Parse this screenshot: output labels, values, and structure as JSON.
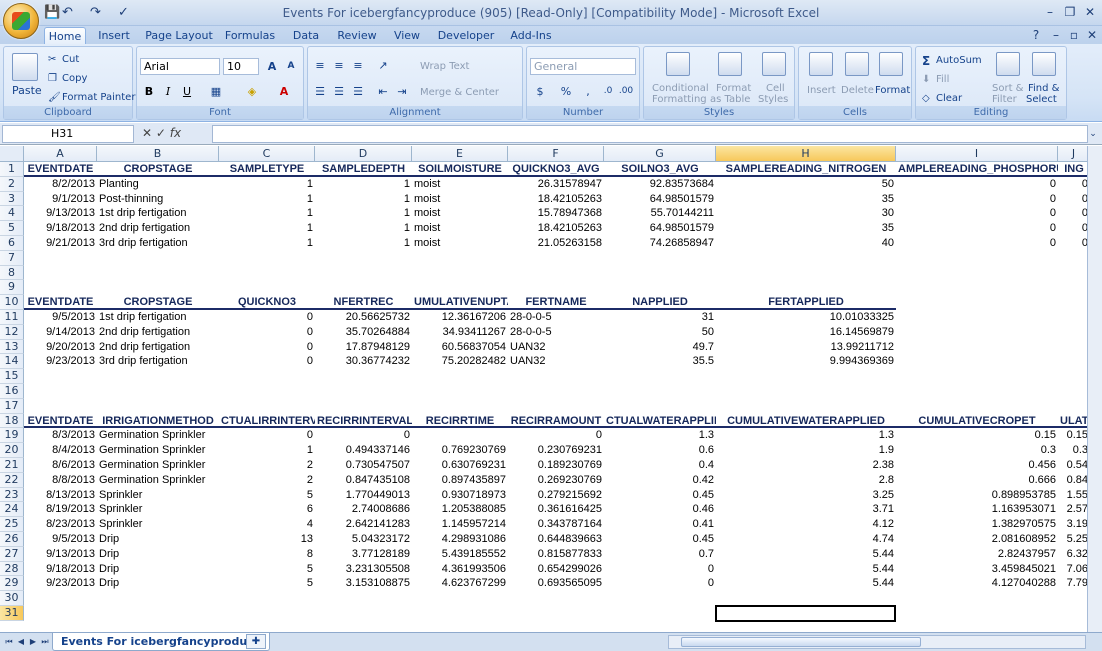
{
  "window": {
    "title": "Events For icebergfancyproduce (905)  [Read-Only]  [Compatibility Mode] - Microsoft Excel"
  },
  "qat": {
    "save": "💾",
    "undo": "↶",
    "redo": "↷",
    "custom": "✓"
  },
  "tabs": [
    "Home",
    "Insert",
    "Page Layout",
    "Formulas",
    "Data",
    "Review",
    "View",
    "Developer",
    "Add-Ins"
  ],
  "ribbon": {
    "clipboard": {
      "label": "Clipboard",
      "paste": "Paste",
      "cut": "Cut",
      "copy": "Copy",
      "format_painter": "Format Painter"
    },
    "font": {
      "label": "Font",
      "name": "Arial",
      "size": "10",
      "grow": "A",
      "shrink": "A",
      "bold": "B",
      "italic": "I",
      "underline": "U"
    },
    "alignment": {
      "label": "Alignment",
      "wrap": "Wrap Text",
      "merge": "Merge & Center"
    },
    "number": {
      "label": "Number",
      "format": "General",
      "currency": "$",
      "percent": "%",
      "comma": ","
    },
    "styles": {
      "label": "Styles",
      "conditional": "Conditional",
      "conditional2": "Formatting",
      "format_table": "Format",
      "format_table2": "as Table",
      "cell_styles": "Cell",
      "cell_styles2": "Styles"
    },
    "cells": {
      "label": "Cells",
      "insert": "Insert",
      "delete": "Delete",
      "format": "Format"
    },
    "editing": {
      "label": "Editing",
      "autosum": "AutoSum",
      "fill": "Fill",
      "clear": "Clear",
      "sort": "Sort &",
      "sort2": "Filter",
      "find": "Find &",
      "find2": "Select"
    }
  },
  "namebox": "H31",
  "columns": [
    "A",
    "B",
    "C",
    "D",
    "E",
    "F",
    "G",
    "H",
    "I",
    "J"
  ],
  "rows": [
    "1",
    "2",
    "3",
    "4",
    "5",
    "6",
    "7",
    "8",
    "9",
    "10",
    "11",
    "12",
    "13",
    "14",
    "15",
    "16",
    "17",
    "18",
    "19",
    "20",
    "21",
    "22",
    "23",
    "24",
    "25",
    "26",
    "27",
    "28",
    "29",
    "30",
    "31"
  ],
  "table1": {
    "headers": [
      "EVENTDATE",
      "CROPSTAGE",
      "SAMPLETYPE",
      "SAMPLEDEPTH",
      "SOILMOISTURE",
      "QUICKNO3_AVG",
      "SOILNO3_AVG",
      "SAMPLEREADING_NITROGEN",
      "AMPLEREADING_PHOSPHORUS",
      "ING"
    ],
    "rows": [
      [
        "8/2/2013",
        "Planting",
        "1",
        "1",
        "moist",
        "26.31578947",
        "92.83573684",
        "50",
        "0",
        "0"
      ],
      [
        "9/1/2013",
        "Post-thinning",
        "1",
        "1",
        "moist",
        "18.42105263",
        "64.98501579",
        "35",
        "0",
        "0"
      ],
      [
        "9/13/2013",
        "1st drip fertigation",
        "1",
        "1",
        "moist",
        "15.78947368",
        "55.70144211",
        "30",
        "0",
        "0"
      ],
      [
        "9/18/2013",
        "2nd drip fertigation",
        "1",
        "1",
        "moist",
        "18.42105263",
        "64.98501579",
        "35",
        "0",
        "0"
      ],
      [
        "9/21/2013",
        "3rd drip fertigation",
        "1",
        "1",
        "moist",
        "21.05263158",
        "74.26858947",
        "40",
        "0",
        "0"
      ]
    ]
  },
  "table2": {
    "headers": [
      "EVENTDATE",
      "CROPSTAGE",
      "QUICKNO3",
      "NFERTREC",
      "UMULATIVENUPTA",
      "FERTNAME",
      "NAPPLIED",
      "FERTAPPLIED"
    ],
    "rows": [
      [
        "9/5/2013",
        "1st drip fertigation",
        "0",
        "20.56625732",
        "12.36167206",
        "28-0-0-5",
        "31",
        "10.01033325"
      ],
      [
        "9/14/2013",
        "2nd drip fertigation",
        "0",
        "35.70264884",
        "34.93411267",
        "28-0-0-5",
        "50",
        "16.14569879"
      ],
      [
        "9/20/2013",
        "2nd drip fertigation",
        "0",
        "17.87948129",
        "60.56837054",
        "UAN32",
        "49.7",
        "13.99211712"
      ],
      [
        "9/23/2013",
        "3rd drip fertigation",
        "0",
        "30.36774232",
        "75.20282482",
        "UAN32",
        "35.5",
        "9.994369369"
      ]
    ]
  },
  "table3": {
    "headers": [
      "EVENTDATE",
      "IRRIGATIONMETHOD",
      "CTUALIRRINTERVA",
      "RECIRRINTERVAL",
      "RECIRRTIME",
      "RECIRRAMOUNT",
      "CTUALWATERAPPLIE",
      "CUMULATIVEWATERAPPLIED",
      "CUMULATIVECROPET",
      "ULAT"
    ],
    "rows": [
      [
        "8/3/2013",
        "Germination Sprinkler",
        "0",
        "0",
        "",
        "0",
        "1.3",
        "1.3",
        "0.15",
        "0.15"
      ],
      [
        "8/4/2013",
        "Germination Sprinkler",
        "1",
        "0.494337146",
        "0.769230769",
        "0.230769231",
        "0.6",
        "1.9",
        "0.3",
        "0.3"
      ],
      [
        "8/6/2013",
        "Germination Sprinkler",
        "2",
        "0.730547507",
        "0.630769231",
        "0.189230769",
        "0.4",
        "2.38",
        "0.456",
        "0.54"
      ],
      [
        "8/8/2013",
        "Germination Sprinkler",
        "2",
        "0.847435108",
        "0.897435897",
        "0.269230769",
        "0.42",
        "2.8",
        "0.666",
        "0.84"
      ],
      [
        "8/13/2013",
        "Sprinkler",
        "5",
        "1.770449013",
        "0.930718973",
        "0.279215692",
        "0.45",
        "3.25",
        "0.898953785",
        "1.55"
      ],
      [
        "8/19/2013",
        "Sprinkler",
        "6",
        "2.74008686",
        "1.205388085",
        "0.361616425",
        "0.46",
        "3.71",
        "1.163953071",
        "2.57"
      ],
      [
        "8/23/2013",
        "Sprinkler",
        "4",
        "2.642141283",
        "1.145957214",
        "0.343787164",
        "0.41",
        "4.12",
        "1.382970575",
        "3.19"
      ],
      [
        "9/5/2013",
        "Drip",
        "13",
        "5.04323172",
        "4.298931086",
        "0.644839663",
        "0.45",
        "4.74",
        "2.081608952",
        "5.25"
      ],
      [
        "9/13/2013",
        "Drip",
        "8",
        "3.77128189",
        "5.439185552",
        "0.815877833",
        "0.7",
        "5.44",
        "2.82437957",
        "6.32"
      ],
      [
        "9/18/2013",
        "Drip",
        "5",
        "3.231305508",
        "4.361993506",
        "0.654299026",
        "0",
        "5.44",
        "3.459845021",
        "7.06"
      ],
      [
        "9/23/2013",
        "Drip",
        "5",
        "3.153108875",
        "4.623767299",
        "0.693565095",
        "0",
        "5.44",
        "4.127040288",
        "7.79"
      ]
    ]
  },
  "sheet_tab": "Events For icebergfancyproduce"
}
